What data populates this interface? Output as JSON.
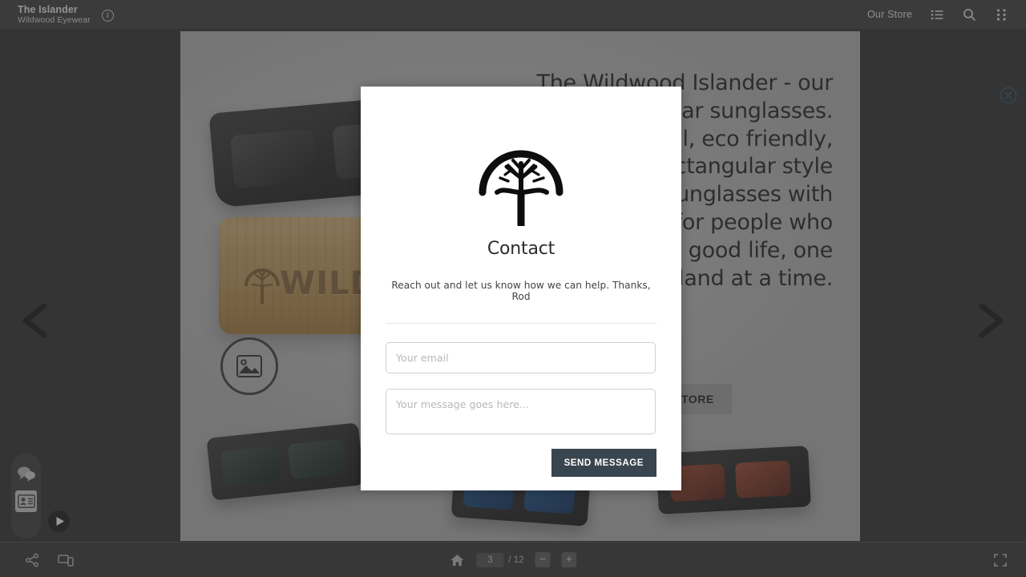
{
  "header": {
    "title": "The Islander",
    "subtitle": "Wildwood Eyewear",
    "info_icon": "info-icon",
    "store_link": "Our Store",
    "icons": [
      "list-icon",
      "search-icon",
      "apps-grid-icon"
    ]
  },
  "slide": {
    "body_text": "The Wildwood Islander - our most popular sunglasses. Beautiful, eco friendly, handcrafted rectangular style maple wood sunglasses with polarized lenses for people who like to live the good life, one island at a time.",
    "cta_label": "VISIT OUR STORE",
    "brand_mark": "WILDWOOD",
    "hotspot_icon": "image-hotspot-icon",
    "prev_icon": "chevron-left-icon",
    "next_icon": "chevron-right-icon"
  },
  "tools": {
    "chat_icon": "chat-bubbles-icon",
    "contact_card_icon": "contact-card-icon",
    "play_icon": "play-icon"
  },
  "bottom_bar": {
    "share_icon": "share-icon",
    "cast_icon": "cast-screen-icon",
    "home_icon": "home-icon",
    "page_current": "3",
    "page_total": "/ 12",
    "zoom_out": "−",
    "zoom_in": "+",
    "fullscreen_icon": "fullscreen-icon"
  },
  "modal": {
    "close_icon": "close-circle-icon",
    "logo_icon": "wildwood-tree-logo",
    "title": "Contact",
    "description": "Reach out and let us know how we can help. Thanks, Rod",
    "email_placeholder": "Your email",
    "email_value": "",
    "message_placeholder": "Your message goes here...",
    "message_value": "",
    "send_label": "SEND MESSAGE"
  },
  "colors": {
    "chrome": "#3c3c3c",
    "stage": "#b9b9b9",
    "accent_button": "#39454e",
    "overlay": "rgba(60,60,60,.52)"
  }
}
